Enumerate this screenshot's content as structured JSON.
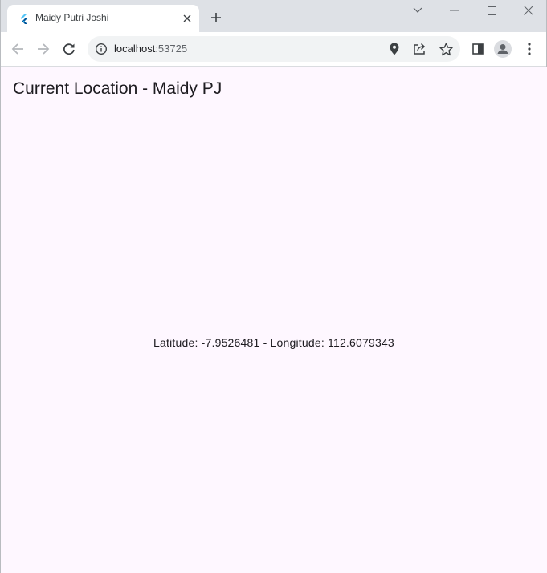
{
  "browser": {
    "tab": {
      "title": "Maidy Putri Joshi"
    },
    "address_bar": {
      "host": "localhost",
      "port": ":53725"
    }
  },
  "page": {
    "title": "Current Location - Maidy PJ",
    "coordinates_text": "Latitude: -7.9526481 - Longitude: 112.6079343"
  },
  "colors": {
    "page_background": "#fef7ff",
    "chrome_background": "#dee1e6",
    "flutter_blue": "#54c5f8"
  }
}
